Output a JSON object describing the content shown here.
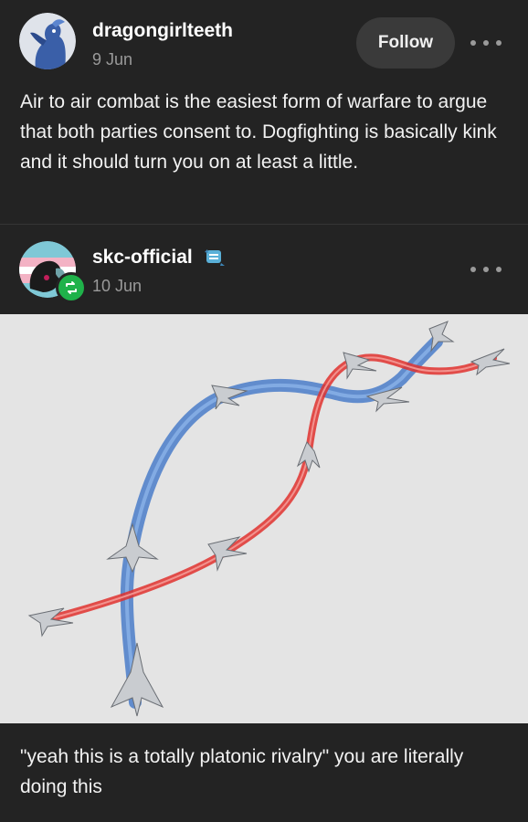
{
  "post": {
    "author": "dragongirlteeth",
    "date": "9 Jun",
    "follow_label": "Follow",
    "text": "Air to air combat is the easiest form of warfare to argue that both parties consent to. Dogfighting is basically kink and it should turn you on at least a little."
  },
  "reblog": {
    "author": "skc-official",
    "date": "10 Jun",
    "caption": "\"yeah this is a totally platonic rivalry\" you are literally doing this"
  },
  "icons": {
    "more": "more-options-icon",
    "reblog": "reblog-icon",
    "verified": "verified-badge-icon"
  },
  "colors": {
    "background": "#232323",
    "reblog_green": "#1fb24a",
    "blue_trail": "#4a7cc9",
    "red_trail": "#e0312e"
  }
}
